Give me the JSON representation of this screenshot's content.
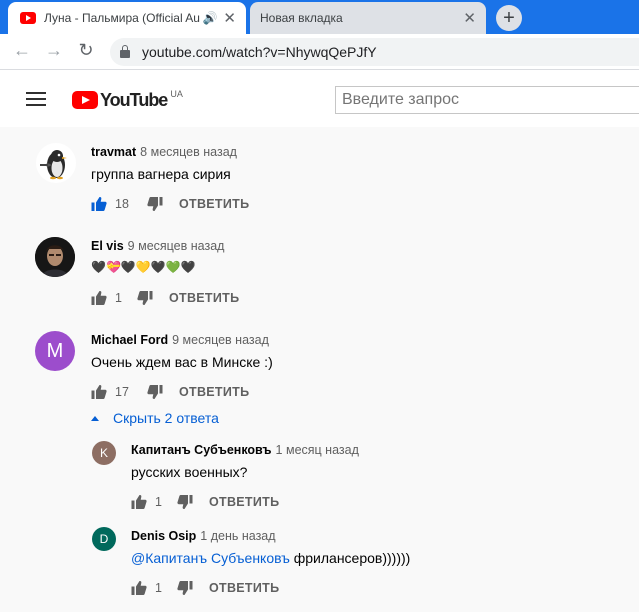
{
  "browser": {
    "tabs": [
      {
        "title": "Луна - Пальмира (Official Au",
        "active": true
      },
      {
        "title": "Новая вкладка",
        "active": false
      }
    ],
    "url": "youtube.com/watch?v=NhywqQePJfY"
  },
  "youtube": {
    "logo_text": "YouTube",
    "country": "UA",
    "search_placeholder": "Введите запрос"
  },
  "comments": [
    {
      "author": "travmat",
      "time": "8 месяцев назад",
      "text": "группа вагнера сирия",
      "likes": "18",
      "liked": true,
      "reply_label": "ОТВЕТИТЬ"
    },
    {
      "author": "El vis",
      "time": "9 месяцев назад",
      "text": "🖤💝🖤💛🖤💚🖤",
      "likes": "1",
      "liked": false,
      "reply_label": "ОТВЕТИТЬ"
    },
    {
      "author": "Michael Ford",
      "time": "9 месяцев назад",
      "text": "Очень ждем вас в Минске :)",
      "likes": "17",
      "liked": false,
      "reply_label": "ОТВЕТИТЬ",
      "avatar_letter": "M",
      "avatar_color": "#9c4dcc",
      "hide_replies": "Скрыть 2 ответа",
      "replies": [
        {
          "author": "Капитанъ Субъенковъ",
          "time": "1 месяц назад",
          "text": "русских военных?",
          "likes": "1",
          "reply_label": "ОТВЕТИТЬ",
          "avatar_letter": "K",
          "avatar_color": "#8d6e63"
        },
        {
          "author": "Denis Osip",
          "time": "1 день назад",
          "mention": "@Капитанъ Субъенковъ",
          "text": " фрилансеров))))))",
          "likes": "1",
          "reply_label": "ОТВЕТИТЬ",
          "avatar_letter": "D",
          "avatar_color": "#00695c"
        }
      ]
    }
  ],
  "colors": {
    "accent_blue": "#065fd4",
    "chrome_blue": "#1a73e8",
    "youtube_red": "#ff0000"
  }
}
